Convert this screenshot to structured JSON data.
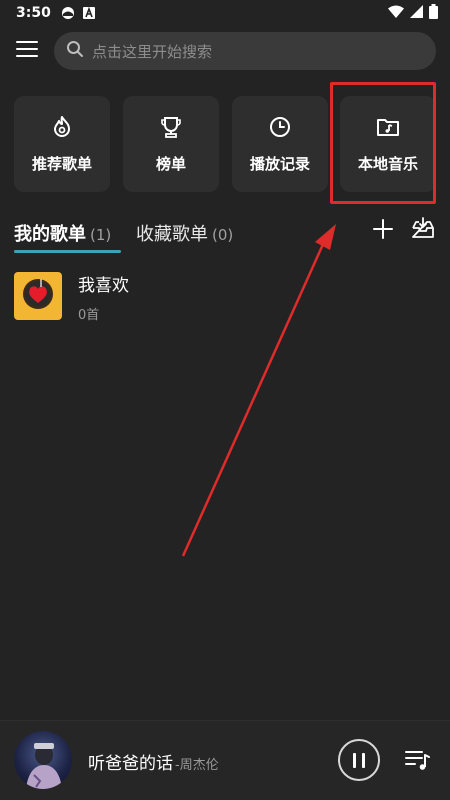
{
  "status_bar": {
    "time": "3:50",
    "icons": [
      "notification-icon",
      "a-icon",
      "wifi-icon",
      "signal-icon",
      "battery-icon"
    ]
  },
  "header": {
    "menu_icon": "menu-icon",
    "search_placeholder": "点击这里开始搜索"
  },
  "quick_access": [
    {
      "label": "推荐歌单",
      "icon": "flame-icon"
    },
    {
      "label": "榜单",
      "icon": "trophy-icon"
    },
    {
      "label": "播放记录",
      "icon": "clock-icon"
    },
    {
      "label": "本地音乐",
      "icon": "music-folder-icon"
    }
  ],
  "tabs": [
    {
      "label": "我的歌单",
      "count": "(1)"
    },
    {
      "label": "收藏歌单",
      "count": "(0)"
    }
  ],
  "tab_actions": [
    "add-icon",
    "import-icon"
  ],
  "playlists": [
    {
      "title": "我喜欢",
      "subtitle": "0首"
    }
  ],
  "now_playing": {
    "title": "听爸爸的话",
    "artist": "-周杰伦"
  },
  "colors": {
    "background": "#232323",
    "card": "#2e2e2e",
    "accent_underline": "#3aa4b6",
    "annotation_red": "#e02b2b",
    "cover_yellow": "#f2b632"
  }
}
